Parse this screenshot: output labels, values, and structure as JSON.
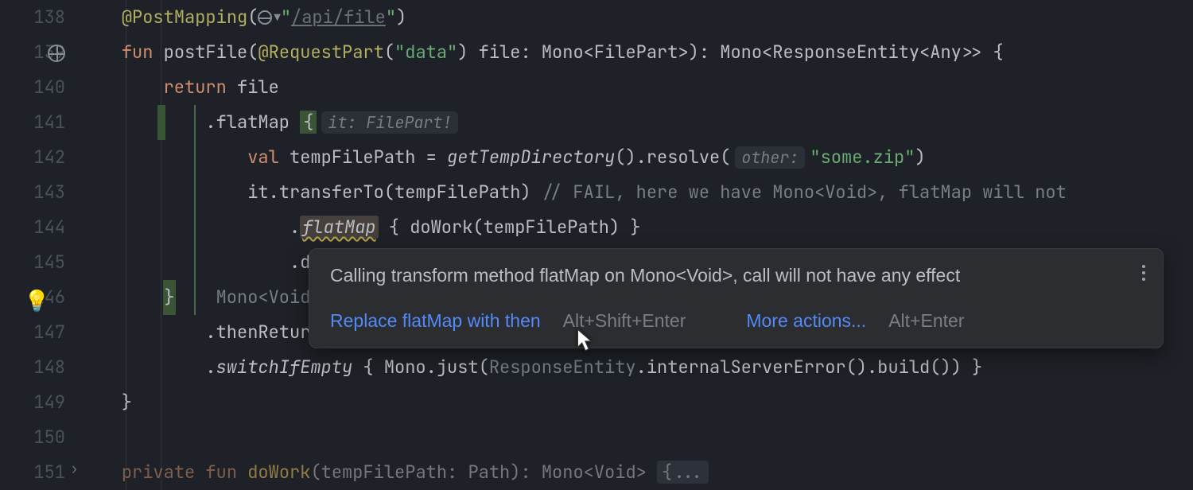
{
  "lines": {
    "start": 138,
    "end": 151
  },
  "code": {
    "l138_ann": "@PostMapping",
    "l138_url": "/api/file",
    "l139_kw1": "fun",
    "l139_fn": "postFile",
    "l139_ann": "@RequestPart",
    "l139_str": "\"data\"",
    "l139_rest": " file: Mono<FilePart>): Mono<ResponseEntity<Any>> {",
    "l140_kw": "return",
    "l140_rest": " file",
    "l141_pre": ".flatMap ",
    "l141_hint": "it: FilePart!",
    "l142_kw": "val",
    "l142_var": " tempFilePath = ",
    "l142_fn": "getTempDirectory",
    "l142_mid": "().resolve(",
    "l142_hint": "other:",
    "l142_str": "\"some.zip\"",
    "l143_pre": "it.transferTo(tempFilePath) ",
    "l143_comment": "// FAIL, here we have Mono<Void>, flatMap will not",
    "l144_fn": "flatMap",
    "l144_rest": " { doWork(tempFilePath) }",
    "l145": ".doFina",
    "l146_hint": "Mono<Void!",
    "l147": ".thenReturn",
    "l148_fn": "switchIfEmpty",
    "l148_mid": " { Mono.just(",
    "l148_fn2": "ResponseEntity",
    "l148_rest": ".internalServerError().build()) }",
    "l151_kw1": "private",
    "l151_kw2": "fun",
    "l151_fn": "doWork",
    "l151_rest": "(tempFilePath: Path): Mono<Void> "
  },
  "tooltip": {
    "title": "Calling transform method flatMap on Mono<Void>, call will not have any effect",
    "action1": "Replace flatMap with then",
    "shortcut1": "Alt+Shift+Enter",
    "action2": "More actions...",
    "shortcut2": "Alt+Enter"
  }
}
